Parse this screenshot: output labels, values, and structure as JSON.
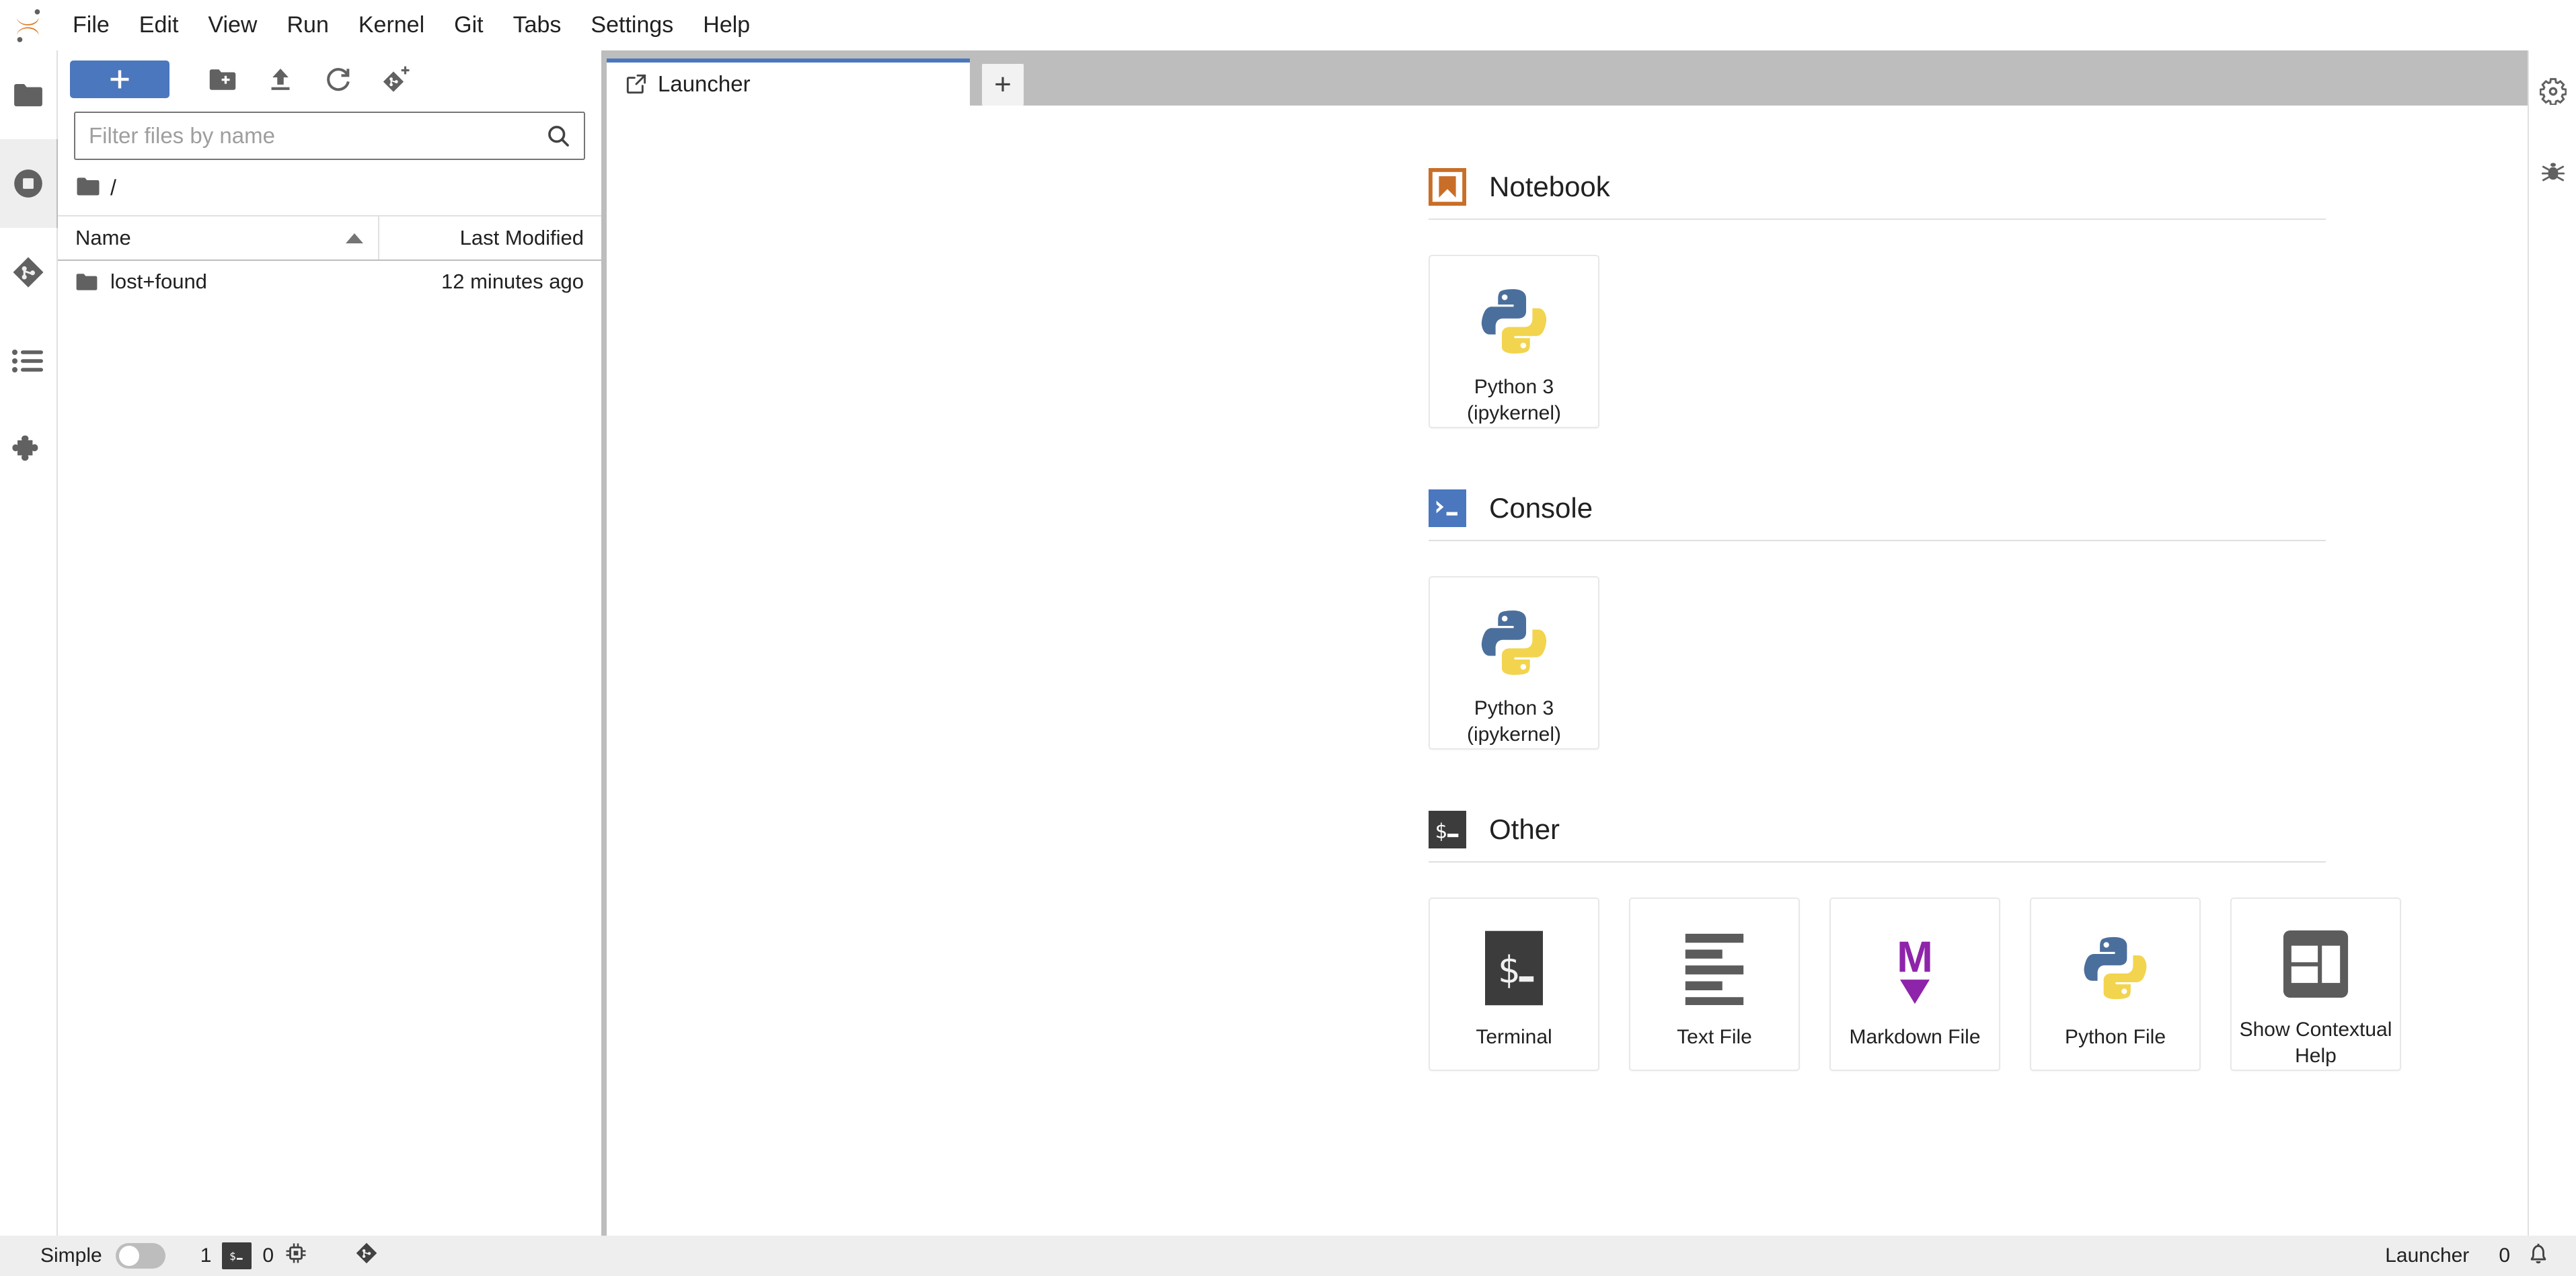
{
  "app": {
    "title": "JupyterLab",
    "logo_icon": "jupyter-logo"
  },
  "menubar": {
    "items": [
      {
        "label": "File",
        "name": "menu-file"
      },
      {
        "label": "Edit",
        "name": "menu-edit"
      },
      {
        "label": "View",
        "name": "menu-view"
      },
      {
        "label": "Run",
        "name": "menu-run"
      },
      {
        "label": "Kernel",
        "name": "menu-kernel"
      },
      {
        "label": "Git",
        "name": "menu-git"
      },
      {
        "label": "Tabs",
        "name": "menu-tabs"
      },
      {
        "label": "Settings",
        "name": "menu-settings"
      },
      {
        "label": "Help",
        "name": "menu-help"
      }
    ]
  },
  "left_sidebar": {
    "items": [
      {
        "icon": "folder-icon",
        "name": "sidebar-item-file-browser",
        "selected": false
      },
      {
        "icon": "running-sessions-icon",
        "name": "sidebar-item-running-terminals-kernels",
        "selected": true
      },
      {
        "icon": "git-icon",
        "name": "sidebar-item-git",
        "selected": false
      },
      {
        "icon": "table-of-contents-icon",
        "name": "sidebar-item-table-of-contents",
        "selected": false
      },
      {
        "icon": "puzzle-icon",
        "name": "sidebar-item-extension-manager",
        "selected": false
      }
    ]
  },
  "file_browser": {
    "toolbar": {
      "new_launcher_label": "+",
      "icons": [
        {
          "icon": "new-folder-icon",
          "name": "new-folder-button"
        },
        {
          "icon": "upload-icon",
          "name": "upload-files-button"
        },
        {
          "icon": "refresh-icon",
          "name": "refresh-file-list-button"
        },
        {
          "icon": "git-clone-icon",
          "name": "git-clone-button"
        }
      ]
    },
    "filter": {
      "placeholder": "Filter files by name",
      "value": "",
      "icon": "search-icon"
    },
    "breadcrumb": {
      "root_icon": "folder-icon",
      "path": "/"
    },
    "columns": {
      "name": "Name",
      "last_modified": "Last Modified",
      "sort_direction": "ascending"
    },
    "rows": [
      {
        "icon": "folder-icon",
        "name": "lost+found",
        "last_modified": "12 minutes ago"
      }
    ]
  },
  "main_area": {
    "tabs": [
      {
        "label": "Launcher",
        "icon": "launcher-icon",
        "name": "tab-launcher",
        "active": true
      }
    ],
    "new_tab_label": "+"
  },
  "launcher": {
    "sections": [
      {
        "id": "notebook",
        "title": "Notebook",
        "icon": "notebook-bookmark-icon",
        "icon_color": "#c96e28",
        "cards": [
          {
            "label": "Python 3\n(ipykernel)",
            "label_line1": "Python 3",
            "label_line2": "(ipykernel)",
            "icon": "python-logo-icon",
            "name": "launcher-card-notebook-python3"
          }
        ]
      },
      {
        "id": "console",
        "title": "Console",
        "icon": "console-prompt-icon",
        "icon_color": "#4b77be",
        "cards": [
          {
            "label": "Python 3\n(ipykernel)",
            "label_line1": "Python 3",
            "label_line2": "(ipykernel)",
            "icon": "python-logo-icon",
            "name": "launcher-card-console-python3"
          }
        ]
      },
      {
        "id": "other",
        "title": "Other",
        "icon": "terminal-prompt-icon",
        "icon_color": "#3c3c3c",
        "cards": [
          {
            "label_line1": "Terminal",
            "label_line2": "",
            "icon": "terminal-icon",
            "name": "launcher-card-terminal"
          },
          {
            "label_line1": "Text File",
            "label_line2": "",
            "icon": "text-file-icon",
            "name": "launcher-card-text-file"
          },
          {
            "label_line1": "Markdown File",
            "label_line2": "",
            "icon": "markdown-icon",
            "name": "launcher-card-markdown-file"
          },
          {
            "label_line1": "Python File",
            "label_line2": "",
            "icon": "python-logo-icon",
            "name": "launcher-card-python-file"
          },
          {
            "label_line1": "Show Contextual",
            "label_line2": "Help",
            "icon": "contextual-help-icon",
            "name": "launcher-card-show-contextual-help"
          }
        ]
      }
    ]
  },
  "right_sidebar": {
    "items": [
      {
        "icon": "property-inspector-icon",
        "name": "right-sidebar-property-inspector"
      },
      {
        "icon": "debugger-icon",
        "name": "right-sidebar-debugger"
      }
    ]
  },
  "statusbar": {
    "simple_label": "Simple",
    "simple_enabled": false,
    "terminal_count": "1",
    "terminal_icon": "terminal-chip-icon",
    "kernel_count": "0",
    "kernel_icon": "cpu-chip-icon",
    "git_icon": "git-icon",
    "active_tab_label": "Launcher",
    "notification_count": "0",
    "notification_icon": "bell-icon"
  },
  "colors": {
    "accent_blue": "#4b77be",
    "notebook_orange": "#c96e28",
    "markdown_purple": "#8e24aa",
    "python_blue": "#4b6f9c",
    "python_yellow": "#f2d44e",
    "icon_grey": "#616161",
    "chrome_grey": "#bdbdbd",
    "statusbar_grey": "#eeeeee"
  }
}
